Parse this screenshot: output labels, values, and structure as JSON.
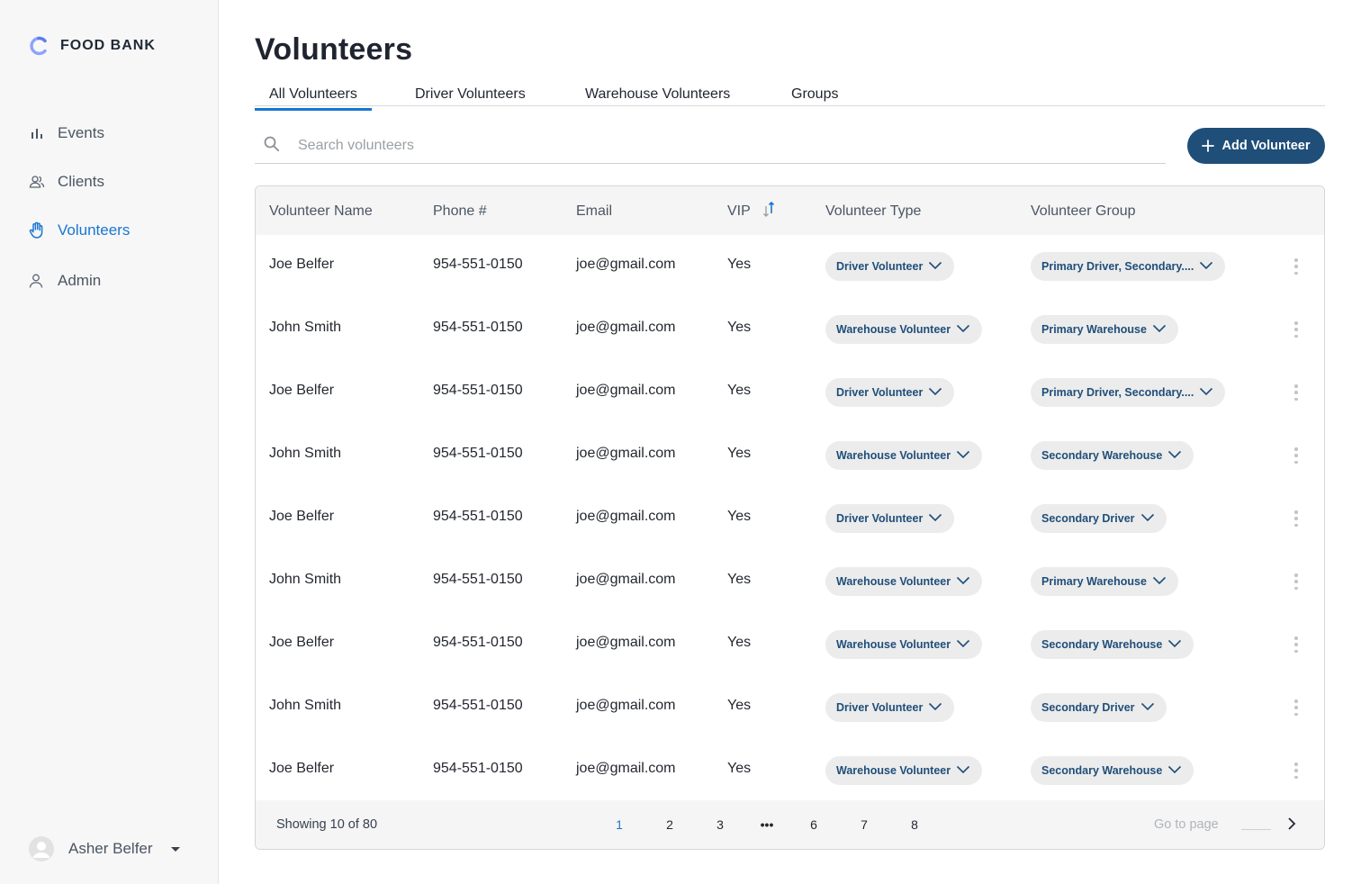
{
  "brand": {
    "name": "FOOD BANK",
    "accent": "#6b8cff"
  },
  "nav": [
    {
      "label": "Events",
      "icon": "bar-chart-icon",
      "active": false
    },
    {
      "label": "Clients",
      "icon": "clients-icon",
      "active": false
    },
    {
      "label": "Volunteers",
      "icon": "hand-icon",
      "active": true
    },
    {
      "label": "Admin",
      "icon": "admin-icon",
      "active": false
    }
  ],
  "user": {
    "name": "Asher Belfer"
  },
  "page": {
    "title": "Volunteers"
  },
  "tabs": [
    {
      "label": "All Volunteers",
      "active": true
    },
    {
      "label": "Driver Volunteers",
      "active": false
    },
    {
      "label": "Warehouse Volunteers",
      "active": false
    },
    {
      "label": "Groups",
      "active": false
    }
  ],
  "search": {
    "placeholder": "Search volunteers",
    "value": ""
  },
  "add_button": {
    "label": "Add Volunteer",
    "color": "#1f4e79"
  },
  "table": {
    "headers": {
      "name": "Volunteer Name",
      "phone": "Phone #",
      "email": "Email",
      "vip": "VIP",
      "type": "Volunteer Type",
      "group": "Volunteer Group"
    },
    "rows": [
      {
        "name": "Joe Belfer",
        "phone": "954-551-0150",
        "email": "joe@gmail.com",
        "vip": "Yes",
        "type": "Driver Volunteer",
        "group": "Primary Driver, Secondary...."
      },
      {
        "name": "John Smith",
        "phone": "954-551-0150",
        "email": "joe@gmail.com",
        "vip": "Yes",
        "type": "Warehouse Volunteer",
        "group": "Primary Warehouse"
      },
      {
        "name": "Joe Belfer",
        "phone": "954-551-0150",
        "email": "joe@gmail.com",
        "vip": "Yes",
        "type": "Driver Volunteer",
        "group": "Primary Driver, Secondary...."
      },
      {
        "name": "John Smith",
        "phone": "954-551-0150",
        "email": "joe@gmail.com",
        "vip": "Yes",
        "type": "Warehouse Volunteer",
        "group": "Secondary Warehouse"
      },
      {
        "name": "Joe Belfer",
        "phone": "954-551-0150",
        "email": "joe@gmail.com",
        "vip": "Yes",
        "type": "Driver Volunteer",
        "group": "Secondary Driver"
      },
      {
        "name": "John Smith",
        "phone": "954-551-0150",
        "email": "joe@gmail.com",
        "vip": "Yes",
        "type": "Warehouse Volunteer",
        "group": "Primary Warehouse"
      },
      {
        "name": "Joe Belfer",
        "phone": "954-551-0150",
        "email": "joe@gmail.com",
        "vip": "Yes",
        "type": "Warehouse Volunteer",
        "group": "Secondary Warehouse"
      },
      {
        "name": "John Smith",
        "phone": "954-551-0150",
        "email": "joe@gmail.com",
        "vip": "Yes",
        "type": "Driver Volunteer",
        "group": "Secondary Driver"
      },
      {
        "name": "Joe Belfer",
        "phone": "954-551-0150",
        "email": "joe@gmail.com",
        "vip": "Yes",
        "type": "Warehouse Volunteer",
        "group": "Secondary Warehouse"
      }
    ]
  },
  "footer": {
    "showing": "Showing 10 of 80",
    "pages": [
      "1",
      "2",
      "3",
      "•••",
      "6",
      "7",
      "8"
    ],
    "current_page": "1",
    "goto_label": "Go to page"
  }
}
